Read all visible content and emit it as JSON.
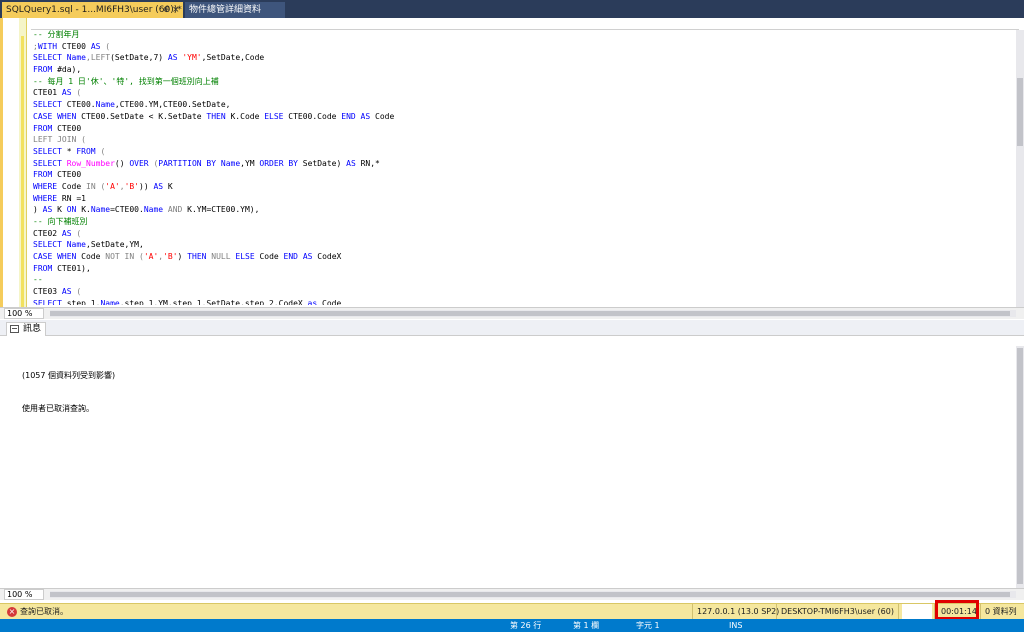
{
  "tabs": {
    "active": "SQLQuery1.sql - 1...MI6FH3\\user (60))*",
    "pin": "⊕",
    "close": "×",
    "second": "物件總管詳細資料"
  },
  "code_lines": [
    {
      "parts": [
        {
          "t": "-- 分割年月",
          "c": "cm"
        }
      ]
    },
    {
      "parts": [
        {
          "t": ";",
          "c": "gr"
        },
        {
          "t": "WITH",
          "c": "kw"
        },
        {
          "t": " CTE00 ",
          "c": ""
        },
        {
          "t": "AS",
          "c": "kw"
        },
        {
          "t": " (",
          "c": "gr"
        }
      ]
    },
    {
      "parts": [
        {
          "t": "SELECT",
          "c": "kw"
        },
        {
          "t": " ",
          "c": ""
        },
        {
          "t": "Name",
          "c": "kw"
        },
        {
          "t": ",",
          "c": "gr"
        },
        {
          "t": "LEFT",
          "c": "gr"
        },
        {
          "t": "(SetDate,7) ",
          "c": ""
        },
        {
          "t": "AS",
          "c": "kw"
        },
        {
          "t": " ",
          "c": ""
        },
        {
          "t": "'YM'",
          "c": "str"
        },
        {
          "t": ",SetDate,Code",
          "c": ""
        }
      ]
    },
    {
      "parts": [
        {
          "t": "FROM",
          "c": "kw"
        },
        {
          "t": " #da),",
          "c": ""
        }
      ]
    },
    {
      "parts": [
        {
          "t": "-- 每月 1 日'休'、'特', 找到第一個班別向上補",
          "c": "cm"
        }
      ]
    },
    {
      "parts": [
        {
          "t": "CTE01 ",
          "c": ""
        },
        {
          "t": "AS",
          "c": "kw"
        },
        {
          "t": " (",
          "c": "gr"
        }
      ]
    },
    {
      "parts": [
        {
          "t": "SELECT",
          "c": "kw"
        },
        {
          "t": " CTE00.",
          "c": ""
        },
        {
          "t": "Name",
          "c": "kw"
        },
        {
          "t": ",CTE00.YM,CTE00.SetDate,",
          "c": ""
        }
      ]
    },
    {
      "parts": [
        {
          "t": "CASE",
          "c": "kw"
        },
        {
          "t": " ",
          "c": ""
        },
        {
          "t": "WHEN",
          "c": "kw"
        },
        {
          "t": " CTE00.SetDate < K.SetDate ",
          "c": ""
        },
        {
          "t": "THEN",
          "c": "kw"
        },
        {
          "t": " K.Code ",
          "c": ""
        },
        {
          "t": "ELSE",
          "c": "kw"
        },
        {
          "t": " CTE00.Code ",
          "c": ""
        },
        {
          "t": "END",
          "c": "kw"
        },
        {
          "t": " ",
          "c": ""
        },
        {
          "t": "AS",
          "c": "kw"
        },
        {
          "t": " Code",
          "c": ""
        }
      ]
    },
    {
      "parts": [
        {
          "t": "FROM",
          "c": "kw"
        },
        {
          "t": " CTE00",
          "c": ""
        }
      ]
    },
    {
      "parts": [
        {
          "t": "LEFT JOIN (",
          "c": "gr"
        }
      ]
    },
    {
      "parts": [
        {
          "t": "SELECT",
          "c": "kw"
        },
        {
          "t": " * ",
          "c": ""
        },
        {
          "t": "FROM",
          "c": "kw"
        },
        {
          "t": " (",
          "c": "gr"
        }
      ]
    },
    {
      "parts": [
        {
          "t": "SELECT",
          "c": "kw"
        },
        {
          "t": " ",
          "c": ""
        },
        {
          "t": "Row_Number",
          "c": "fn"
        },
        {
          "t": "() ",
          "c": ""
        },
        {
          "t": "OVER",
          "c": "kw"
        },
        {
          "t": " (",
          "c": "gr"
        },
        {
          "t": "PARTITION BY",
          "c": "kw"
        },
        {
          "t": " ",
          "c": ""
        },
        {
          "t": "Name",
          "c": "kw"
        },
        {
          "t": ",YM ",
          "c": ""
        },
        {
          "t": "ORDER BY",
          "c": "kw"
        },
        {
          "t": " SetDate) ",
          "c": ""
        },
        {
          "t": "AS",
          "c": "kw"
        },
        {
          "t": " RN,*",
          "c": ""
        }
      ]
    },
    {
      "parts": [
        {
          "t": "FROM",
          "c": "kw"
        },
        {
          "t": " CTE00",
          "c": ""
        }
      ]
    },
    {
      "parts": [
        {
          "t": "WHERE",
          "c": "kw"
        },
        {
          "t": " Code ",
          "c": ""
        },
        {
          "t": "IN",
          "c": "gr"
        },
        {
          "t": " (",
          "c": "gr"
        },
        {
          "t": "'A'",
          "c": "str"
        },
        {
          "t": ",",
          "c": "gr"
        },
        {
          "t": "'B'",
          "c": "str"
        },
        {
          "t": ")) ",
          "c": ""
        },
        {
          "t": "AS",
          "c": "kw"
        },
        {
          "t": " K",
          "c": ""
        }
      ]
    },
    {
      "parts": [
        {
          "t": "WHERE",
          "c": "kw"
        },
        {
          "t": " RN =1",
          "c": ""
        }
      ]
    },
    {
      "parts": [
        {
          "t": ") ",
          "c": ""
        },
        {
          "t": "AS",
          "c": "kw"
        },
        {
          "t": " K ",
          "c": ""
        },
        {
          "t": "ON",
          "c": "kw"
        },
        {
          "t": " K.",
          "c": ""
        },
        {
          "t": "Name",
          "c": "kw"
        },
        {
          "t": "=CTE00.",
          "c": ""
        },
        {
          "t": "Name",
          "c": "kw"
        },
        {
          "t": " ",
          "c": ""
        },
        {
          "t": "AND",
          "c": "gr"
        },
        {
          "t": " K.YM=CTE00.YM),",
          "c": ""
        }
      ]
    },
    {
      "parts": [
        {
          "t": "-- 向下補班別",
          "c": "cm"
        }
      ]
    },
    {
      "parts": [
        {
          "t": "CTE02 ",
          "c": ""
        },
        {
          "t": "AS",
          "c": "kw"
        },
        {
          "t": " (",
          "c": "gr"
        }
      ]
    },
    {
      "parts": [
        {
          "t": "SELECT",
          "c": "kw"
        },
        {
          "t": " ",
          "c": ""
        },
        {
          "t": "Name",
          "c": "kw"
        },
        {
          "t": ",SetDate,YM,",
          "c": ""
        }
      ]
    },
    {
      "parts": [
        {
          "t": "CASE",
          "c": "kw"
        },
        {
          "t": " ",
          "c": ""
        },
        {
          "t": "WHEN",
          "c": "kw"
        },
        {
          "t": " Code ",
          "c": ""
        },
        {
          "t": "NOT IN",
          "c": "gr"
        },
        {
          "t": " (",
          "c": "gr"
        },
        {
          "t": "'A'",
          "c": "str"
        },
        {
          "t": ",",
          "c": "gr"
        },
        {
          "t": "'B'",
          "c": "str"
        },
        {
          "t": ") ",
          "c": ""
        },
        {
          "t": "THEN",
          "c": "kw"
        },
        {
          "t": " ",
          "c": ""
        },
        {
          "t": "NULL",
          "c": "gr"
        },
        {
          "t": " ",
          "c": ""
        },
        {
          "t": "ELSE",
          "c": "kw"
        },
        {
          "t": " Code ",
          "c": ""
        },
        {
          "t": "END",
          "c": "kw"
        },
        {
          "t": " ",
          "c": ""
        },
        {
          "t": "AS",
          "c": "kw"
        },
        {
          "t": " CodeX",
          "c": ""
        }
      ]
    },
    {
      "parts": [
        {
          "t": "FROM",
          "c": "kw"
        },
        {
          "t": " CTE01),",
          "c": ""
        }
      ]
    },
    {
      "parts": [
        {
          "t": "--",
          "c": "cm"
        }
      ]
    },
    {
      "parts": [
        {
          "t": "CTE03 ",
          "c": ""
        },
        {
          "t": "AS",
          "c": "kw"
        },
        {
          "t": " (",
          "c": "gr"
        }
      ]
    },
    {
      "parts": [
        {
          "t": "SELECT",
          "c": "kw"
        },
        {
          "t": " step_1.",
          "c": ""
        },
        {
          "t": "Name",
          "c": "kw"
        },
        {
          "t": ",step_1.YM,step_1.SetDate,step_2.CodeX ",
          "c": ""
        },
        {
          "t": "as",
          "c": "kw"
        },
        {
          "t": " Code",
          "c": ""
        }
      ]
    }
  ],
  "editor": {
    "zoom": "100 %"
  },
  "messages": {
    "tab_label": "訊息",
    "lines": [
      "(1057 個資料列受到影響)",
      "使用者已取消查詢。"
    ],
    "zoom": "100 %"
  },
  "status": {
    "error_icon": "×",
    "message": "查詢已取消。",
    "server": "127.0.0.1 (13.0 SP2)",
    "user": "DESKTOP-TMI6FH3\\user (60)",
    "time": "00:01:14",
    "rows": "0 資料列"
  },
  "footer": {
    "line": "第 26 行",
    "col": "第 1 欄",
    "char": "字元 1",
    "mode": "INS"
  },
  "colors": {
    "accent_yellow": "#f5cc5b",
    "status_yellow": "#f5e79e",
    "tab_bg": "#2b3c5a",
    "footer_blue": "#007acc",
    "highlight_red": "#e00000"
  }
}
